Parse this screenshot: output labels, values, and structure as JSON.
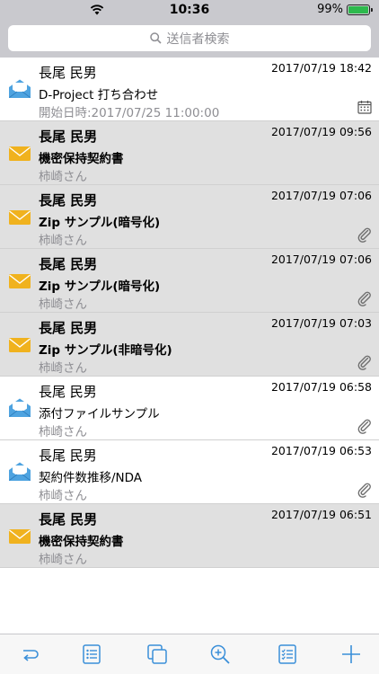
{
  "status_bar": {
    "time": "10:36",
    "battery": "99%"
  },
  "search": {
    "placeholder": "送信者検索"
  },
  "messages": [
    {
      "sender": "長尾 民男",
      "date": "2017/07/19 18:42",
      "subject": "D-Project 打ち合わせ",
      "line3": "開始日時:2017/07/25 11:00:00",
      "unread": false,
      "icon": "open-envelope-icon",
      "badge": "calendar-icon"
    },
    {
      "sender": "長尾 民男",
      "date": "2017/07/19 09:56",
      "subject": "機密保持契約書",
      "line3": "柿崎さん",
      "unread": true,
      "icon": "closed-envelope-icon",
      "badge": ""
    },
    {
      "sender": "長尾 民男",
      "date": "2017/07/19 07:06",
      "subject": "Zip サンプル(暗号化)",
      "line3": "柿崎さん",
      "unread": true,
      "icon": "closed-envelope-icon",
      "badge": "paperclip-icon"
    },
    {
      "sender": "長尾 民男",
      "date": "2017/07/19 07:06",
      "subject": "Zip サンプル(暗号化)",
      "line3": "柿崎さん",
      "unread": true,
      "icon": "closed-envelope-icon",
      "badge": "paperclip-icon"
    },
    {
      "sender": "長尾 民男",
      "date": "2017/07/19 07:03",
      "subject": "Zip サンプル(非暗号化)",
      "line3": "柿崎さん",
      "unread": true,
      "icon": "closed-envelope-icon",
      "badge": "paperclip-icon"
    },
    {
      "sender": "長尾 民男",
      "date": "2017/07/19 06:58",
      "subject": "添付ファイルサンプル",
      "line3": "柿崎さん",
      "unread": false,
      "icon": "open-envelope-icon",
      "badge": "paperclip-icon"
    },
    {
      "sender": "長尾 民男",
      "date": "2017/07/19 06:53",
      "subject": "契約件数推移/NDA",
      "line3": "柿崎さん",
      "unread": false,
      "icon": "open-envelope-icon",
      "badge": "paperclip-icon"
    },
    {
      "sender": "長尾 民男",
      "date": "2017/07/19 06:51",
      "subject": "機密保持契約書",
      "line3": "柿崎さん",
      "unread": true,
      "icon": "closed-envelope-icon",
      "badge": ""
    }
  ],
  "toolbar": {
    "icons": [
      "reply-icon",
      "list-icon",
      "copy-icon",
      "zoom-icon",
      "checklist-icon",
      "add-icon"
    ]
  },
  "colors": {
    "accent": "#3a8fd9",
    "closed_envelope": "#f0b21e",
    "open_envelope": "#4ea3e0",
    "alt_row": "#e0e0e0"
  }
}
